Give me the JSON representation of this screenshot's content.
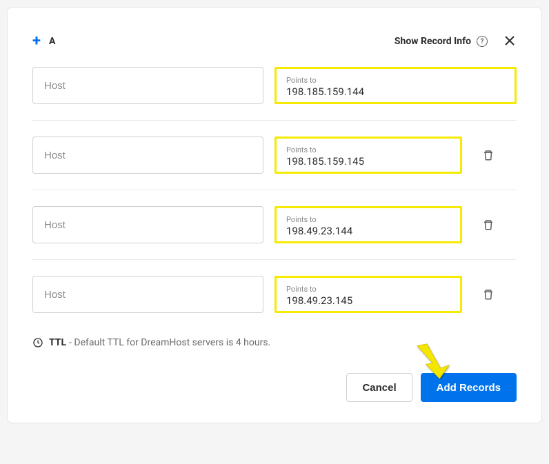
{
  "header": {
    "record_type": "A",
    "show_info_label": "Show Record Info"
  },
  "rows": [
    {
      "host_placeholder": "Host",
      "points_label": "Points to",
      "points_value": "198.185.159.144",
      "has_delete": false
    },
    {
      "host_placeholder": "Host",
      "points_label": "Points to",
      "points_value": "198.185.159.145",
      "has_delete": true
    },
    {
      "host_placeholder": "Host",
      "points_label": "Points to",
      "points_value": "198.49.23.144",
      "has_delete": true
    },
    {
      "host_placeholder": "Host",
      "points_label": "Points to",
      "points_value": "198.49.23.145",
      "has_delete": true
    }
  ],
  "ttl": {
    "label": "TTL",
    "text": " - Default TTL for DreamHost servers is 4 hours."
  },
  "footer": {
    "cancel_label": "Cancel",
    "submit_label": "Add Records"
  },
  "colors": {
    "highlight": "#f5ea00",
    "primary": "#0073ec"
  }
}
